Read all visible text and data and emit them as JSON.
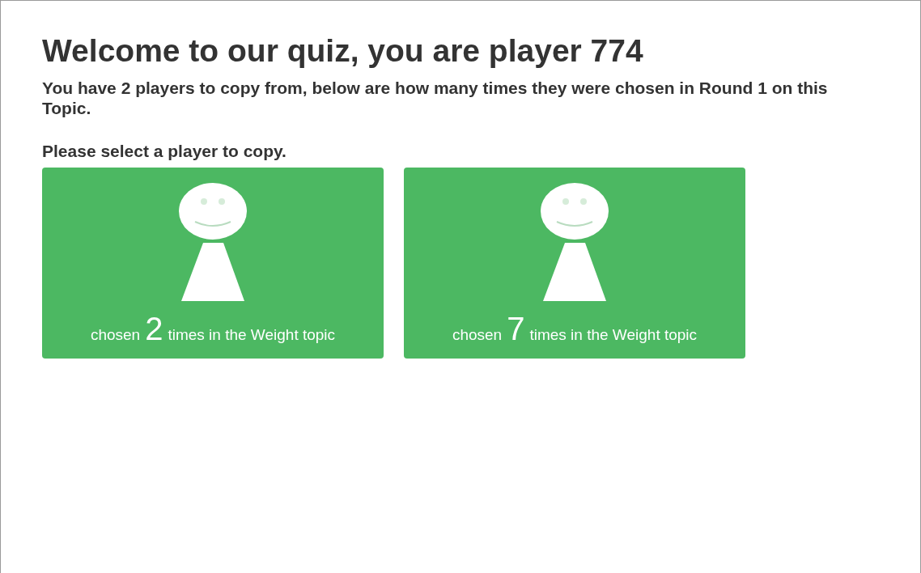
{
  "heading": "Welcome to our quiz, you are player 774",
  "intro": "You have 2 players to copy from, below are how many times they were chosen in Round 1 on this Topic.",
  "prompt": "Please select a player to copy.",
  "players": [
    {
      "prefix": "chosen",
      "count": "2",
      "suffix": "times in the Weight topic"
    },
    {
      "prefix": "chosen",
      "count": "7",
      "suffix": "times in the Weight topic"
    }
  ]
}
